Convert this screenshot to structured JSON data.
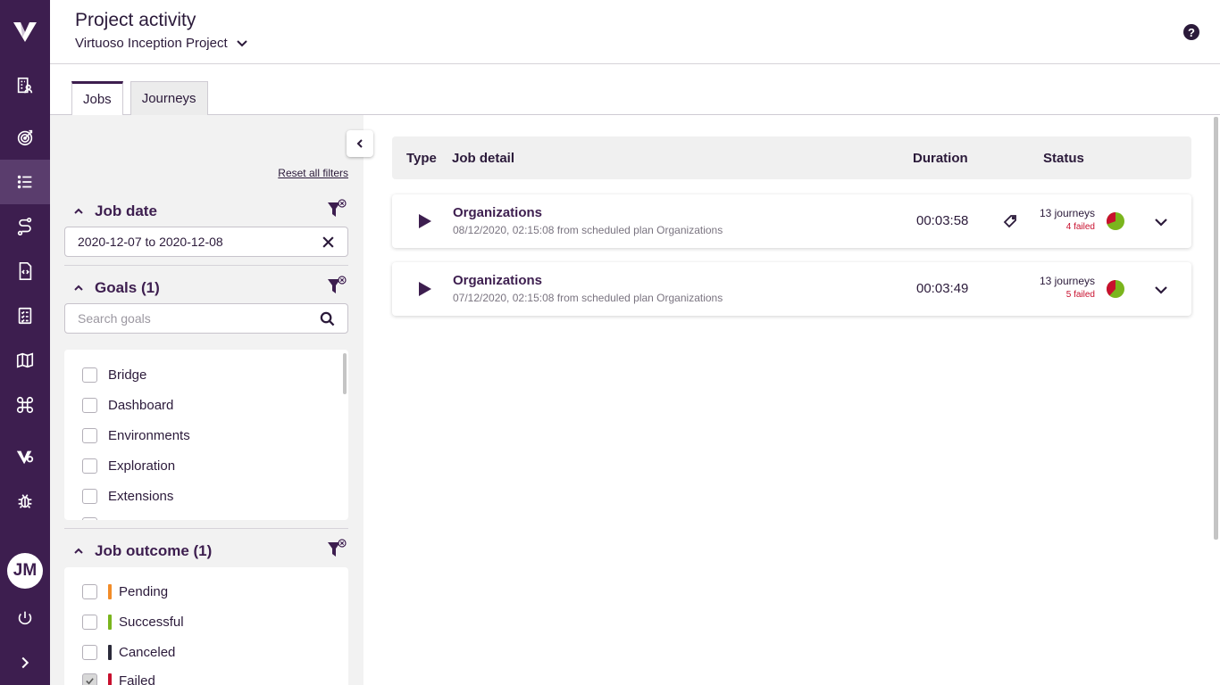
{
  "header": {
    "title": "Project activity",
    "project": "Virtuoso Inception Project"
  },
  "user": {
    "initials": "JM"
  },
  "tabs": [
    "Jobs",
    "Journeys"
  ],
  "filters": {
    "reset_label": "Reset all filters",
    "job_date": {
      "title": "Job date",
      "value": "2020-12-07 to 2020-12-08"
    },
    "goals": {
      "title": "Goals (1)",
      "placeholder": "Search goals",
      "items": [
        "Bridge",
        "Dashboard",
        "Environments",
        "Exploration",
        "Extensions"
      ]
    },
    "job_outcome": {
      "title": "Job outcome (1)",
      "items": [
        {
          "label": "Pending",
          "color": "#f28c28",
          "checked": false
        },
        {
          "label": "Successful",
          "color": "#7ab51d",
          "checked": false
        },
        {
          "label": "Canceled",
          "color": "#2b2a3a",
          "checked": false
        },
        {
          "label": "Failed",
          "color": "#c8102e",
          "checked": true
        }
      ]
    }
  },
  "table": {
    "headers": {
      "type": "Type",
      "detail": "Job detail",
      "duration": "Duration",
      "status": "Status"
    },
    "rows": [
      {
        "name": "Organizations",
        "subtitle": "08/12/2020, 02:15:08 from scheduled plan Organizations",
        "duration": "00:03:58",
        "journeys": "13 journeys",
        "failed": "4 failed",
        "failed_count": 4,
        "total": 13
      },
      {
        "name": "Organizations",
        "subtitle": "07/12/2020, 02:15:08 from scheduled plan Organizations",
        "duration": "00:03:49",
        "journeys": "13 journeys",
        "failed": "5 failed",
        "failed_count": 5,
        "total": 13
      }
    ]
  },
  "colors": {
    "sidebar": "#3d1e4f",
    "accent": "#3d1e4f",
    "failed": "#c8102e",
    "success": "#7ab51d"
  }
}
